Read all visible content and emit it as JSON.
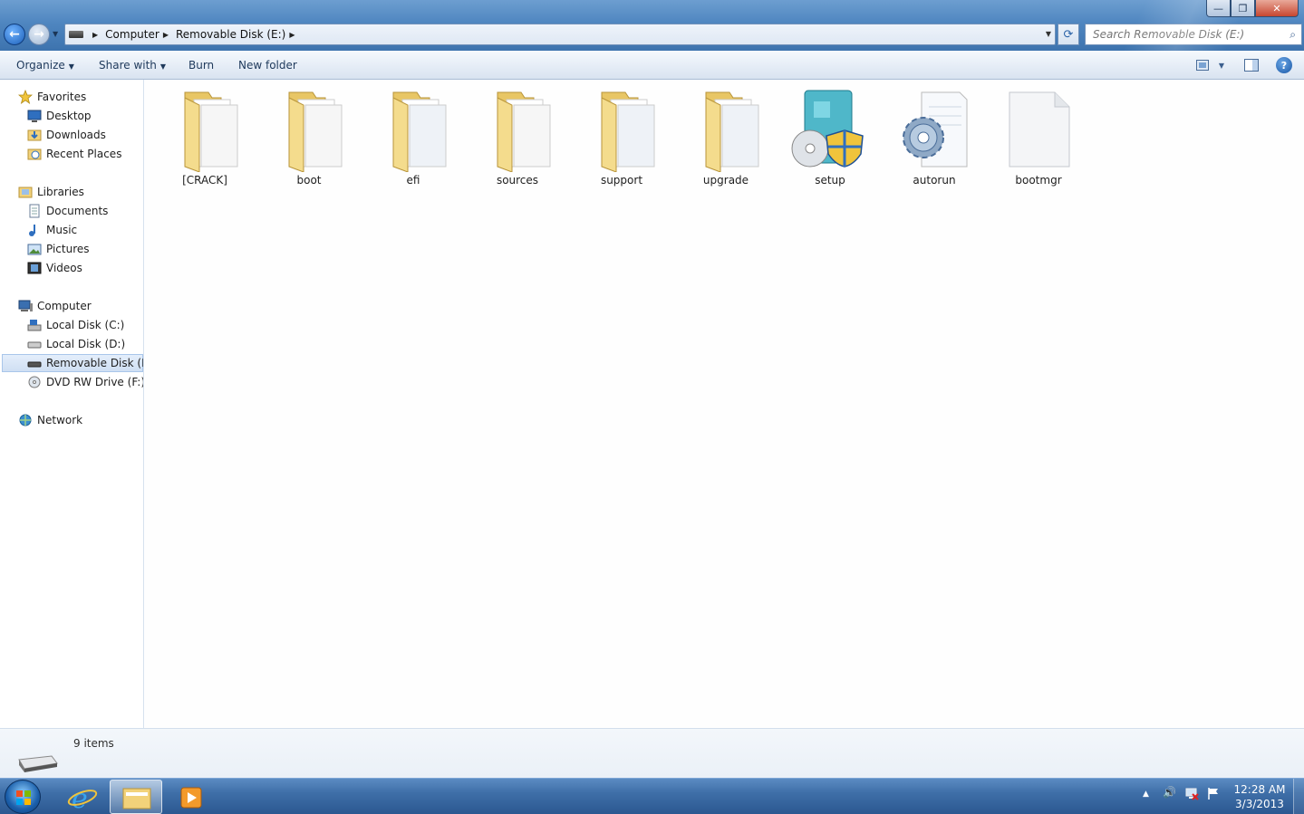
{
  "window": {
    "controls": {
      "minimize": "—",
      "maximize": "❐",
      "close": "✕"
    }
  },
  "address": {
    "crumbs": [
      "Computer",
      "Removable Disk (E:)"
    ],
    "search_placeholder": "Search Removable Disk (E:)"
  },
  "toolbar": {
    "organize": "Organize",
    "share_with": "Share with",
    "burn": "Burn",
    "new_folder": "New folder"
  },
  "navigation": {
    "favorites": "Favorites",
    "desktop": "Desktop",
    "downloads": "Downloads",
    "recent_places": "Recent Places",
    "libraries": "Libraries",
    "documents": "Documents",
    "music": "Music",
    "pictures": "Pictures",
    "videos": "Videos",
    "computer": "Computer",
    "local_c": "Local Disk (C:)",
    "local_d": "Local Disk (D:)",
    "removable_e": "Removable Disk (E:)",
    "dvd_f": "DVD RW Drive (F:) W",
    "network": "Network"
  },
  "files": [
    {
      "name": "[CRACK]",
      "type": "folder"
    },
    {
      "name": "boot",
      "type": "folder"
    },
    {
      "name": "efi",
      "type": "folder"
    },
    {
      "name": "sources",
      "type": "folder"
    },
    {
      "name": "support",
      "type": "folder"
    },
    {
      "name": "upgrade",
      "type": "folder"
    },
    {
      "name": "setup",
      "type": "setup-exe"
    },
    {
      "name": "autorun",
      "type": "settings-file"
    },
    {
      "name": "bootmgr",
      "type": "blank-file"
    }
  ],
  "status": {
    "item_count": "9 items"
  },
  "taskbar": {
    "time": "12:28 AM",
    "date": "3/3/2013"
  },
  "colors": {
    "folder": "#f2d27a",
    "accent": "#3f6fa8"
  }
}
